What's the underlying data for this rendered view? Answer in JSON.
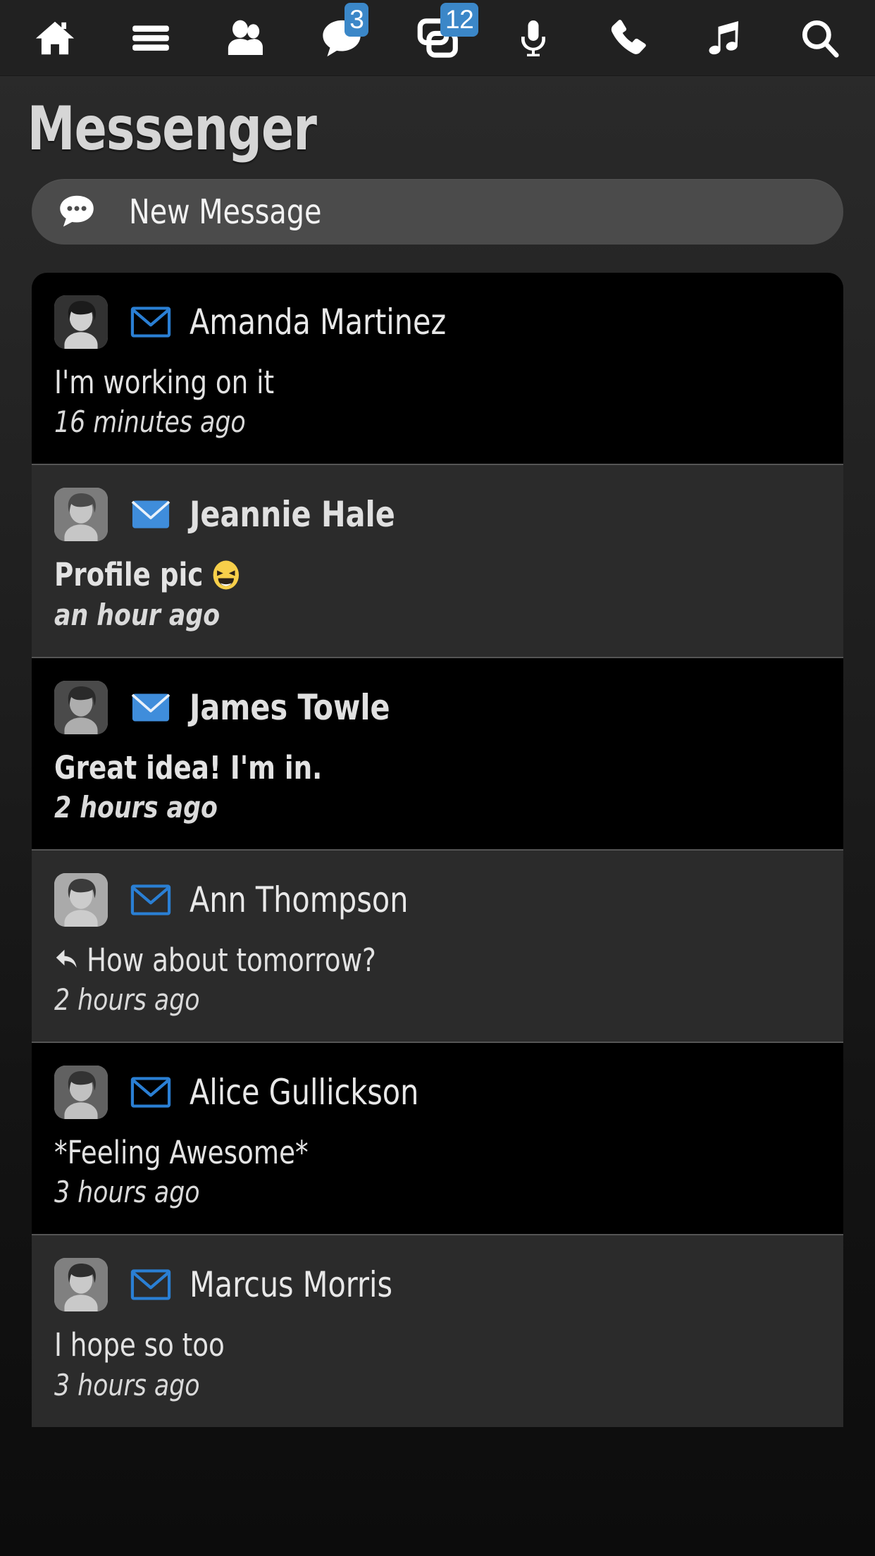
{
  "topbar": {
    "background": "#212121",
    "badge_color": "#3b87c8",
    "items": [
      {
        "icon": "home-icon",
        "label": "Home",
        "badge": ""
      },
      {
        "icon": "menu-icon",
        "label": "Menu",
        "badge": ""
      },
      {
        "icon": "friends-icon",
        "label": "Friends",
        "badge": ""
      },
      {
        "icon": "messages-icon",
        "label": "Messages",
        "badge": "3"
      },
      {
        "icon": "feed-icon",
        "label": "Feed",
        "badge": "12"
      },
      {
        "icon": "microphone-icon",
        "label": "Voice",
        "badge": ""
      },
      {
        "icon": "phone-icon",
        "label": "Calls",
        "badge": ""
      },
      {
        "icon": "music-note-icon",
        "label": "Music",
        "badge": ""
      },
      {
        "icon": "search-icon",
        "label": "Search",
        "badge": ""
      }
    ]
  },
  "header": {
    "title": "Messenger"
  },
  "new_message": {
    "label": "New Message",
    "icon": "chat-bubble-dots-icon"
  },
  "conversations": [
    {
      "name": "Amanda Martinez",
      "snippet": "I'm working on it",
      "time": "16 minutes ago",
      "unread": false,
      "envelope": "envelope-open-outline-icon",
      "reply": false,
      "emoji": "",
      "avatar": "avatar-amanda"
    },
    {
      "name": "Jeannie Hale",
      "snippet": "Profile pic",
      "time": "an hour ago",
      "unread": true,
      "envelope": "envelope-filled-icon",
      "reply": false,
      "emoji": "grinning-squinting-face",
      "avatar": "avatar-jeannie"
    },
    {
      "name": "James Towle",
      "snippet": "Great idea! I'm in.",
      "time": "2 hours ago",
      "unread": true,
      "envelope": "envelope-filled-icon",
      "reply": false,
      "emoji": "",
      "avatar": "avatar-james"
    },
    {
      "name": "Ann Thompson",
      "snippet": "How about tomorrow?",
      "time": "2 hours ago",
      "unread": false,
      "envelope": "envelope-open-outline-icon",
      "reply": true,
      "emoji": "",
      "avatar": "avatar-ann"
    },
    {
      "name": "Alice Gullickson",
      "snippet": "*Feeling Awesome*",
      "time": "3 hours ago",
      "unread": false,
      "envelope": "envelope-open-outline-icon",
      "reply": false,
      "emoji": "",
      "avatar": "avatar-alice"
    },
    {
      "name": "Marcus Morris",
      "snippet": "I hope so too",
      "time": "3 hours ago",
      "unread": false,
      "envelope": "envelope-open-outline-icon",
      "reply": false,
      "emoji": "",
      "avatar": "avatar-marcus"
    }
  ]
}
